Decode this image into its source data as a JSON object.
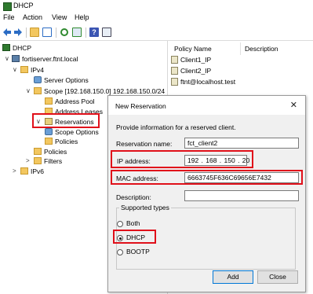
{
  "window": {
    "title": "DHCP"
  },
  "menu": [
    "File",
    "Action",
    "View",
    "Help"
  ],
  "toolbar": {
    "icons": [
      "back-arrow-icon",
      "forward-arrow-icon",
      "folder-up-icon",
      "show-hide-tree-icon",
      "refresh-icon",
      "export-icon",
      "help-icon",
      "properties-icon"
    ]
  },
  "tree": {
    "root": "DHCP",
    "server": "fortiserver.ftnt.local",
    "ipv4": "IPv4",
    "server_options": "Server Options",
    "scope": "Scope [192.168.150.0] 192.168.150.0/24",
    "address_pool": "Address Pool",
    "address_leases": "Address Leases",
    "reservations": "Reservations",
    "scope_options": "Scope Options",
    "policies_scope": "Policies",
    "policies": "Policies",
    "filters": "Filters",
    "ipv6": "IPv6"
  },
  "list": {
    "columns": [
      "Policy Name",
      "Description"
    ],
    "rows": [
      "Client1_IP",
      "Client2_IP",
      "ftnt@localhost.test"
    ]
  },
  "dialog": {
    "title": "New Reservation",
    "intro": "Provide information for a reserved client.",
    "reservation_name_label": "Reservation name:",
    "reservation_name_value": "fct_client2",
    "ip_label": "IP address:",
    "ip_value": "192 . 168 . 150 . 20",
    "mac_label": "MAC address:",
    "mac_value": "6663745F636C69656E7432",
    "description_label": "Description:",
    "description_value": "",
    "supported_types_label": "Supported types",
    "types": [
      "Both",
      "DHCP",
      "BOOTP"
    ],
    "selected_type": "DHCP",
    "add_label": "Add",
    "close_label": "Close"
  },
  "colors": {
    "highlight": "#e0101a",
    "default_button_border": "#0078d7"
  }
}
